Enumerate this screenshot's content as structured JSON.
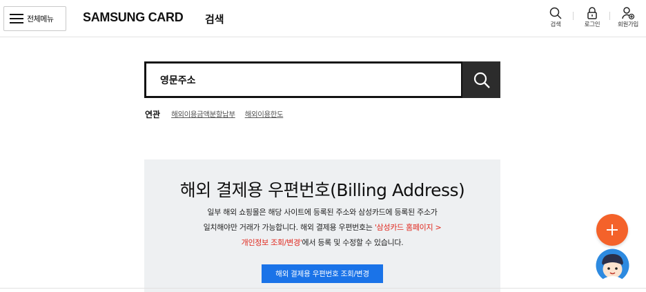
{
  "header": {
    "menu_label": "전체메뉴",
    "logo": "SAMSUNG CARD",
    "title": "검색",
    "utils": {
      "search": "검색",
      "login": "로그인",
      "join": "회원가입"
    }
  },
  "search": {
    "value": "영문주소",
    "button_icon": "search-icon"
  },
  "related": {
    "title": "연관",
    "links": [
      "해외이용금액분할납부",
      "해외이용한도"
    ]
  },
  "card": {
    "title": "해외 결제용 우편번호(Billing Address)",
    "desc_line1": "일부 해외 쇼핑몰은 해당 사이트에 등록된 주소와 삼성카드에 등록된 주소가",
    "desc_line2_start": "일치해야만 거래가 가능합니다. 해외 결제용 우편번호는 ",
    "desc_red_1": "'삼성카드 홈페이지 >",
    "desc_red_2": "개인정보 조회/변경'",
    "desc_line3_end": "에서 등록 및 수정할 수 있습니다.",
    "button": "해외 결제용 우편번호 조회/변경"
  },
  "colors": {
    "accent_red": "#e0271d",
    "button_blue": "#1a73e8",
    "fab_orange": "#f4622a",
    "search_btn": "#2c2c2c",
    "card_bg": "#eef0f2"
  },
  "floating": {
    "plus_icon": "plus-icon",
    "chatbot_icon": "chatbot-avatar-icon"
  }
}
